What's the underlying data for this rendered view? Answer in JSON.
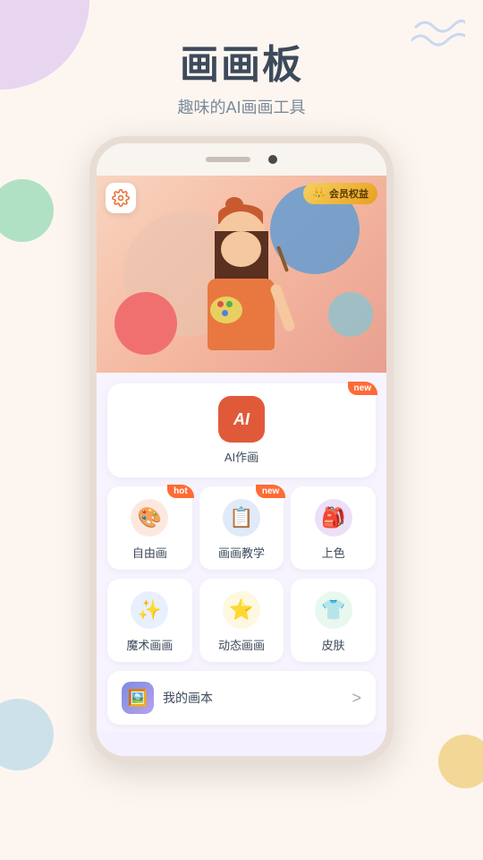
{
  "app": {
    "title": "画画板",
    "subtitle": "趣味的AI画画工具"
  },
  "phone": {
    "speaker_label": "speaker",
    "camera_label": "camera"
  },
  "banner": {
    "settings_icon": "gear",
    "vip_crown": "👑",
    "vip_label": "会员权益"
  },
  "features": {
    "ai_paint": {
      "label": "AI作画",
      "badge": "new",
      "icon_text": "AI"
    },
    "grid_row1": [
      {
        "id": "free-draw",
        "label": "自由画",
        "badge": "hot",
        "icon": "🎨",
        "icon_bg": "#fde8e0"
      },
      {
        "id": "tutorial",
        "label": "画画教学",
        "badge": "new",
        "icon": "📋",
        "icon_bg": "#e0eaf8"
      },
      {
        "id": "color",
        "label": "上色",
        "badge": null,
        "icon": "🎒",
        "icon_bg": "#ece0f8"
      }
    ],
    "grid_row2": [
      {
        "id": "magic-paint",
        "label": "魔术画画",
        "badge": null,
        "icon": "✨",
        "icon_bg": "#e8f0fd"
      },
      {
        "id": "dynamic-paint",
        "label": "动态画画",
        "badge": null,
        "icon": "⭐",
        "icon_bg": "#fef8e0"
      },
      {
        "id": "skin",
        "label": "皮肤",
        "badge": null,
        "icon": "👕",
        "icon_bg": "#e8f8ee"
      }
    ]
  },
  "sketchbook": {
    "icon": "🖼️",
    "label": "我的画本",
    "chevron": ">"
  },
  "badges": {
    "new": "new",
    "hot": "hot"
  }
}
